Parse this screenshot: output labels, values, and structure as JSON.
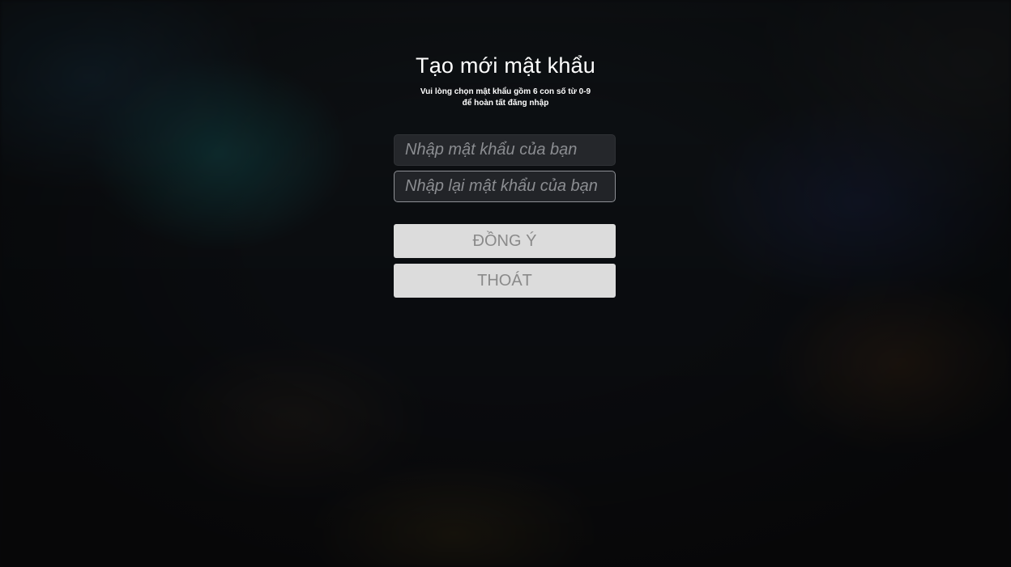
{
  "dialog": {
    "title": "Tạo mới mật khẩu",
    "subtitle_line1": "Vui lòng chọn mật khẩu gồm 6 con số từ 0-9",
    "subtitle_line2": "để hoàn tất đăng nhập"
  },
  "fields": {
    "password": {
      "value": "",
      "placeholder": "Nhập mật khẩu của bạn"
    },
    "confirm_password": {
      "value": "",
      "placeholder": "Nhập lại mật khẩu của bạn"
    }
  },
  "buttons": {
    "confirm_label": "ĐỒNG Ý",
    "exit_label": "THOÁT"
  },
  "colors": {
    "button_bg": "#dcdcdc",
    "button_text": "#8a8a8a",
    "field_bg": "#25272b",
    "focused_border": "#8e9095"
  }
}
